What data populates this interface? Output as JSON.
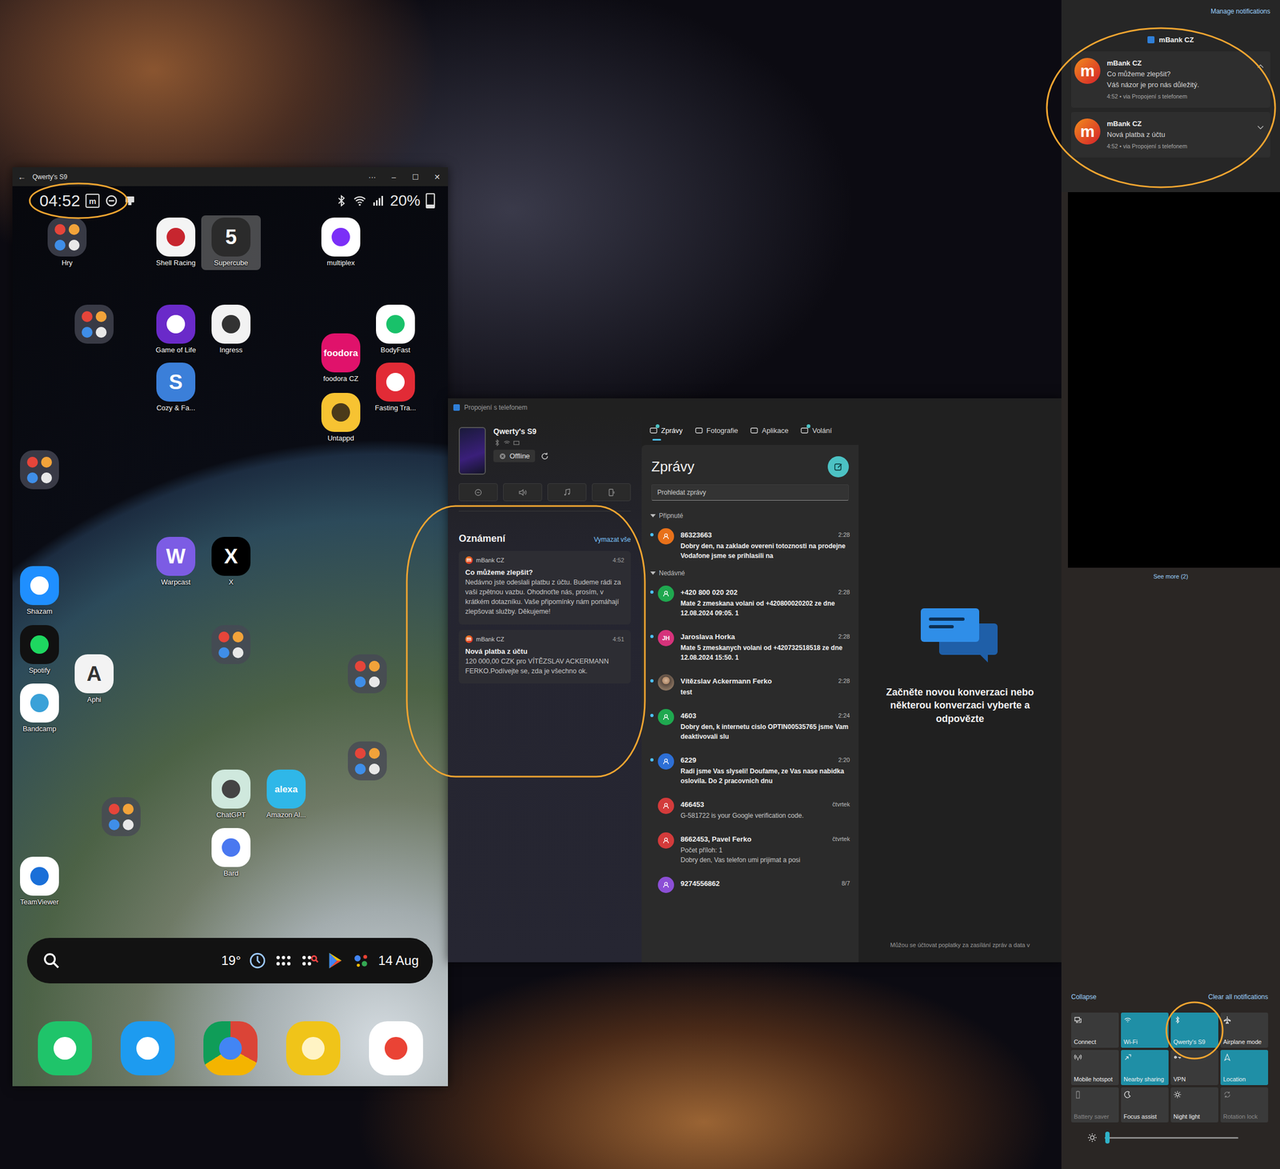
{
  "phone_window": {
    "title": "Qwerty's S9",
    "back": "←",
    "controls": [
      "···",
      "–",
      "☐",
      "✕"
    ],
    "status_bar": {
      "time": "04:52",
      "app_badge": "m",
      "battery": "20%",
      "battery_level": 0.2
    },
    "apps": [
      {
        "kind": "folder",
        "label": "Hry",
        "focused": false
      },
      {
        "kind": "app",
        "label": "Shell Racing",
        "focused": false
      },
      {
        "kind": "app",
        "label": "Supercube",
        "glyph": "5",
        "focused": true
      },
      {
        "kind": "app",
        "label": "multiplex",
        "focused": false
      },
      {
        "kind": "folder",
        "focused": false
      },
      {
        "kind": "app",
        "label": "Game of Life",
        "focused": false
      },
      {
        "kind": "app",
        "label": "Ingress",
        "focused": false
      },
      {
        "kind": "app",
        "label": "BodyFast",
        "focused": false
      },
      {
        "kind": "app",
        "label": "foodora CZ",
        "glyph": "foodora",
        "focused": false
      },
      {
        "kind": "app",
        "label": "Cozy & Fa...",
        "glyph": "S",
        "focused": false
      },
      {
        "kind": "app",
        "label": "Fasting Tra...",
        "focused": false
      },
      {
        "kind": "app",
        "label": "Untappd",
        "focused": false
      },
      {
        "kind": "folder",
        "focused": false
      },
      {
        "kind": "app",
        "label": "Warpcast",
        "glyph": "W",
        "focused": false
      },
      {
        "kind": "app",
        "label": "X",
        "glyph": "X",
        "focused": false
      },
      {
        "kind": "app",
        "label": "Shazam",
        "focused": false
      },
      {
        "kind": "app",
        "label": "Spotify",
        "focused": false
      },
      {
        "kind": "folder",
        "focused": false
      },
      {
        "kind": "app",
        "label": "Aphi",
        "glyph": "A",
        "focused": false
      },
      {
        "kind": "folder",
        "focused": false
      },
      {
        "kind": "app",
        "label": "Bandcamp",
        "focused": false
      },
      {
        "kind": "folder",
        "focused": false
      },
      {
        "kind": "app",
        "label": "ChatGPT",
        "focused": false
      },
      {
        "kind": "app",
        "label": "Amazon Al...",
        "glyph": "alexa",
        "focused": false
      },
      {
        "kind": "folder",
        "focused": false
      },
      {
        "kind": "app",
        "label": "Bard",
        "focused": false
      },
      {
        "kind": "app",
        "label": "TeamViewer",
        "focused": false
      }
    ],
    "search_bar": {
      "temperature": "19°",
      "date": "14 Aug"
    }
  },
  "phone_link": {
    "title": "Propojení s telefonem",
    "device": {
      "name": "Qwerty's S9",
      "status": "Offline",
      "connected": false
    },
    "notifications": {
      "title": "Oznámení",
      "clear": "Vymazat vše",
      "items": [
        {
          "app": "mBank CZ",
          "logo": "m",
          "time": "4:52",
          "title": "Co můžeme zlepšit?",
          "body": "Nedávno jste odeslali platbu z účtu. Budeme rádi za vaši zpětnou vazbu. Ohodnoťte nás, prosím, v krátkém dotazníku. Vaše připomínky nám pomáhají zlepšovat služby. Děkujeme!"
        },
        {
          "app": "mBank CZ",
          "logo": "m",
          "time": "4:51",
          "title": "Nová platba z účtu",
          "body": "120 000,00 CZK pro VÍTĚZSLAV ACKERMANN FERKO.Podívejte se, zda je všechno ok."
        }
      ]
    },
    "tabs": [
      {
        "label": "Zprávy",
        "selected": true,
        "badge": true
      },
      {
        "label": "Fotografie",
        "selected": false,
        "badge": false
      },
      {
        "label": "Aplikace",
        "selected": false,
        "badge": false
      },
      {
        "label": "Volání",
        "selected": false,
        "badge": true
      }
    ],
    "messages": {
      "title": "Zprávy",
      "search_placeholder": "Prohledat zprávy",
      "sections": [
        {
          "label": "Připnuté",
          "expanded": true,
          "items": [
            {
              "name": "86323663",
              "time": "2:28",
              "lines": [
                "Dobry den, na zaklade overeni totoznosti na prodejne Vodafone jsme se prihlasili na"
              ],
              "unread": true,
              "kind": "person",
              "color": "#e8711a"
            }
          ]
        },
        {
          "label": "Nedávné",
          "expanded": true,
          "items": [
            {
              "name": "+420 800 020 202",
              "time": "2:28",
              "lines": [
                "Mate 2 zmeskana volani od +420800020202 ze dne 12.08.2024 09:05. 1"
              ],
              "unread": true,
              "kind": "person",
              "color": "#1fa84f"
            },
            {
              "name": "Jaroslava Horka",
              "time": "2:28",
              "lines": [
                "Mate 5 zmeskanych volani od +420732518518 ze dne 12.08.2024 15:50. 1"
              ],
              "unread": true,
              "kind": "initials",
              "initials": "JH",
              "color": "#d6337b"
            },
            {
              "name": "Vítězslav Ackermann Ferko",
              "time": "2:28",
              "lines": [
                "test"
              ],
              "unread": true,
              "kind": "photo",
              "color": "#8a7460"
            },
            {
              "name": "4603",
              "time": "2:24",
              "lines": [
                "Dobry den, k internetu cislo OPTIN00535765 jsme Vam deaktivovali slu"
              ],
              "unread": true,
              "kind": "person",
              "color": "#1fa84f"
            },
            {
              "name": "6229",
              "time": "2:20",
              "lines": [
                "Radi jsme Vas slyseli! Doufame, ze Vas nase nabidka oslovila. Do 2 pracovnich dnu"
              ],
              "unread": true,
              "kind": "person",
              "color": "#2d6fd6"
            },
            {
              "name": "466453",
              "time": "čtvrtek",
              "lines": [
                "G-581722 is your Google verification code."
              ],
              "unread": false,
              "kind": "person",
              "color": "#d33b3b"
            },
            {
              "name": "8662453, Pavel Ferko",
              "time": "čtvrtek",
              "lines": [
                "Počet příloh: 1",
                "Dobry den, Vas telefon umi prijimat a posi"
              ],
              "unread": false,
              "kind": "person",
              "color": "#d33b3b"
            },
            {
              "name": "9274556862",
              "time": "8/7",
              "lines": [],
              "unread": false,
              "kind": "person",
              "color": "#8c4fd6"
            }
          ]
        }
      ]
    },
    "empty_state": {
      "text": "Začněte novou konverzaci nebo některou konverzaci vyberte a odpovězte",
      "footer": "Můžou se účtovat poplatky za zasílání zpráv a data v"
    }
  },
  "notification_center": {
    "manage": "Manage notifications",
    "group": "mBank CZ",
    "items": [
      {
        "app": "mBank CZ",
        "logo": "m",
        "title": "Co můžeme zlepšit?",
        "body": "Váš názor je pro nás důležitý.",
        "meta": "4:52 • via Propojení s telefonem",
        "expanded": true
      },
      {
        "app": "mBank CZ",
        "logo": "m",
        "title": "Nová platba z účtu",
        "meta": "4:52 • via Propojení s telefonem",
        "expanded": false
      }
    ],
    "see_more": "See more (2)",
    "collapse": "Collapse",
    "clear_all": "Clear all notifications",
    "tiles": [
      {
        "label": "Connect",
        "on": false,
        "disabled": false
      },
      {
        "label": "Wi-Fi",
        "on": true,
        "disabled": false
      },
      {
        "label": "Qwerty's S9",
        "on": true,
        "disabled": false
      },
      {
        "label": "Airplane mode",
        "on": false,
        "disabled": false
      },
      {
        "label": "Mobile hotspot",
        "on": false,
        "disabled": false
      },
      {
        "label": "Nearby sharing",
        "on": true,
        "disabled": false
      },
      {
        "label": "VPN",
        "on": false,
        "disabled": false
      },
      {
        "label": "Location",
        "on": true,
        "disabled": false
      },
      {
        "label": "Battery saver",
        "on": false,
        "disabled": true
      },
      {
        "label": "Focus assist",
        "on": false,
        "disabled": false
      },
      {
        "label": "Night light",
        "on": false,
        "disabled": false
      },
      {
        "label": "Rotation lock",
        "on": false,
        "disabled": true
      }
    ],
    "brightness": {
      "level": 0.02
    }
  }
}
